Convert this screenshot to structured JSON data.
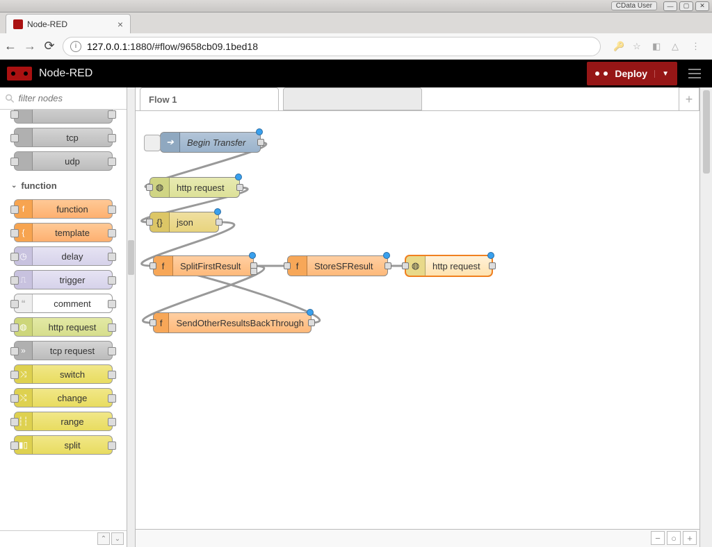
{
  "titlebar": {
    "user": "CData User"
  },
  "browser": {
    "tab_title": "Node-RED",
    "url_host": "127.0.0.1",
    "url_rest": ":1880/#flow/9658cb09.1bed18"
  },
  "header": {
    "title": "Node-RED",
    "deploy": "Deploy"
  },
  "palette": {
    "filter_placeholder": "filter nodes",
    "group_above": [
      {
        "name": "tcp"
      },
      {
        "name": "udp"
      }
    ],
    "section": "function",
    "items": [
      {
        "name": "function",
        "cls": "orange",
        "glyph": "f"
      },
      {
        "name": "template",
        "cls": "orange",
        "glyph": "{"
      },
      {
        "name": "delay",
        "cls": "lilac",
        "glyph": "◷"
      },
      {
        "name": "trigger",
        "cls": "lilac",
        "glyph": "⎍"
      },
      {
        "name": "comment",
        "cls": "white",
        "glyph": ""
      },
      {
        "name": "http request",
        "cls": "lime",
        "glyph": "◍"
      },
      {
        "name": "tcp request",
        "cls": "gray",
        "glyph": "»"
      },
      {
        "name": "switch",
        "cls": "yellow",
        "glyph": "⤨"
      },
      {
        "name": "change",
        "cls": "yellow",
        "glyph": "⤭"
      },
      {
        "name": "range",
        "cls": "yellow",
        "glyph": "┆┆"
      },
      {
        "name": "split",
        "cls": "yellow",
        "glyph": "▮▯"
      }
    ]
  },
  "tabs": {
    "active": "Flow 1"
  },
  "nodes": {
    "n0": "Begin Transfer",
    "n1": "http request",
    "n2": "json",
    "n3": "SplitFirstResult",
    "n4": "StoreSFResult",
    "n5": "http request",
    "n6": "SendOtherResultsBackThrough"
  }
}
